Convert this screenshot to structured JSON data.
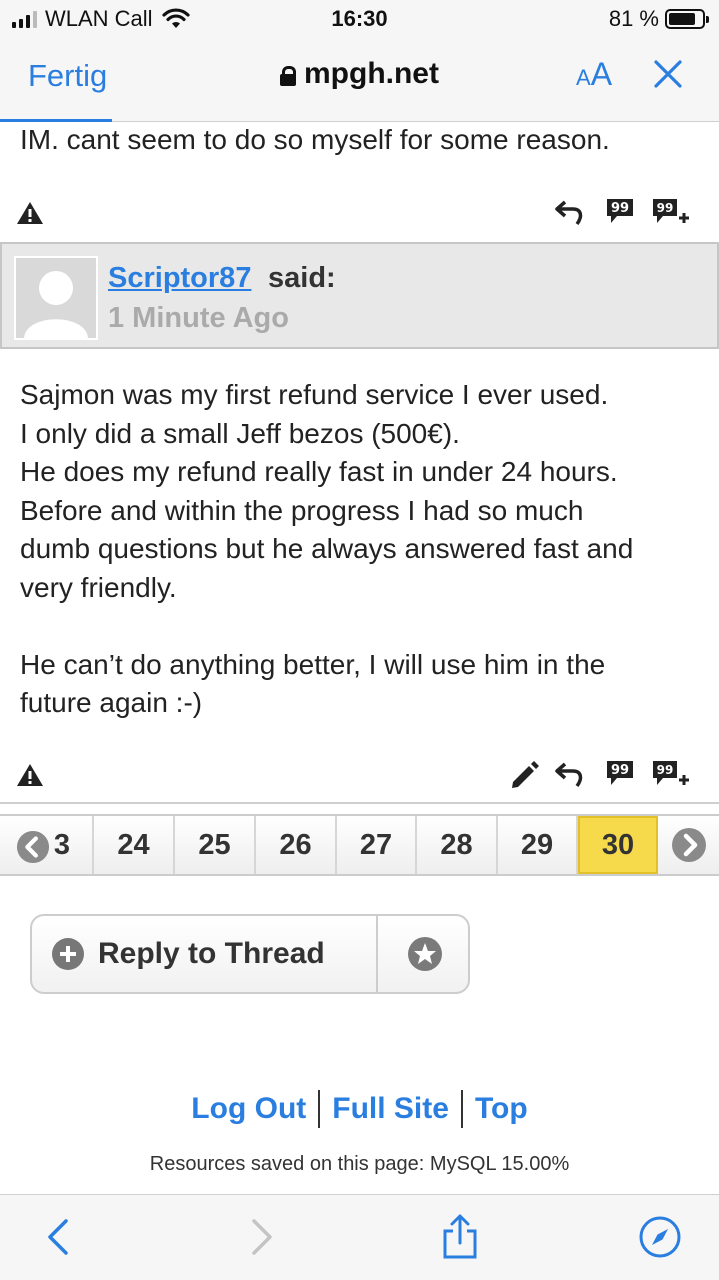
{
  "status_bar": {
    "carrier": "WLAN Call",
    "time": "16:30",
    "battery_percent_label": "81 %",
    "battery_level": 0.81
  },
  "nav": {
    "done_label": "Fertig",
    "url": "mpgh.net",
    "text_size_label_small": "A",
    "text_size_label_large": "A",
    "close_icon": "close-icon"
  },
  "previous_post": {
    "text_fragment": "IM. cant seem to do so myself for some reason."
  },
  "post": {
    "author": "Scriptor87",
    "said": "said:",
    "time_ago": "1 Minute Ago",
    "paragraph_lines": [
      "Sajmon was my first refund service I ever used.",
      "I only did a small Jeff bezos (500€).",
      "He does my refund really fast in under 24 hours.",
      "Before and within the progress I had so much",
      "dumb questions but he always answered fast and",
      "very friendly.",
      "",
      "He can’t do anything better, I will use him in the",
      "future again :-)"
    ]
  },
  "pagination": {
    "partial_page": "3",
    "pages": [
      "24",
      "25",
      "26",
      "27",
      "28",
      "29",
      "30"
    ],
    "current_page": "30"
  },
  "reply": {
    "reply_label": "Reply to Thread"
  },
  "footer": {
    "logout": "Log Out",
    "full_site": "Full Site",
    "top": "Top",
    "resources": "Resources saved on this page: MySQL 15.00%"
  },
  "colors": {
    "link_blue": "#2a7ee0",
    "current_page_yellow": "#f6da4c"
  }
}
